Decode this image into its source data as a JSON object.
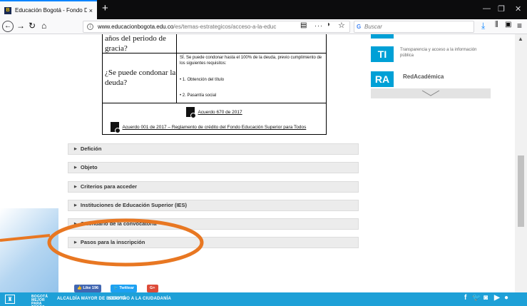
{
  "browser": {
    "tab_title": "Educación Bogotá - Fondo Dist",
    "tab_close": "×",
    "new_tab": "+",
    "url_domain": "www.educacionbogota.edu.co",
    "url_path": "/es/temas-estrategicos/acceso-a-la-educ",
    "search_placeholder": "Buscar",
    "page_actions": "···",
    "icons": [
      "back-icon",
      "forward-icon",
      "reload-icon",
      "home-icon",
      "reader-icon",
      "pocket-icon",
      "bookmark-star-icon",
      "download-icon",
      "library-icon",
      "sidebar-icon",
      "menu-icon"
    ]
  },
  "table": {
    "row1_question": "años del periodo de gracia?",
    "row2_question": "¿Se puede condonar la deuda?",
    "row2_answer_intro": "SÍ. Se puede condonar hasta el 100% de la deuda, previo cumplimiento de los siguientes requisitos:",
    "row2_item1": "• 1. Obtención del título",
    "row2_item2": "• 2. Pasantía social",
    "doc1": "Acuerdo 670 de 2017",
    "doc2": "Acuerdo 001 de 2017 – Reglamento de crédito del Fondo Educación Superior para Todos"
  },
  "accordion": [
    {
      "label": "Defición"
    },
    {
      "label": "Objeto"
    },
    {
      "label": "Criterios para acceder"
    },
    {
      "label": "Instituciones de Educación Superior (IES)"
    },
    {
      "label": "Calendario de la convocatoria"
    },
    {
      "label": "Pasos para la inscripción"
    }
  ],
  "sidebar": {
    "ti_badge": "TI",
    "ti_text": "Transparencia y acceso a la información pública",
    "ra_badge": "RA",
    "ra_text": "RedAcadémica"
  },
  "social": {
    "like": "Like 196",
    "twitter": "Twittear",
    "gplus": "G+"
  },
  "footer": {
    "brand": "BOGOTÁ MEJOR PARA TODOS",
    "alcaldia": "ALCALDÍA MAYOR DE BOGOTÁ",
    "servicio": "SERVICIO A LA CIUDADANÍA"
  },
  "colors": {
    "accent": "#1ea0d7",
    "highlight_ring": "#e87722",
    "badge": "#00a0d6"
  }
}
